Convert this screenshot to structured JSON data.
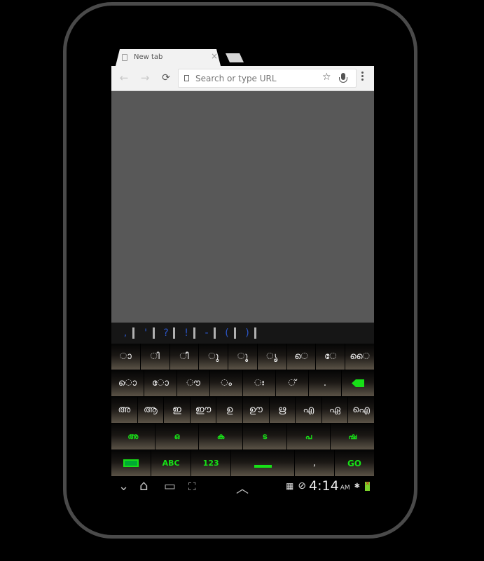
{
  "browser": {
    "tab_title": "New tab",
    "omnibox_placeholder": "Search or type URL",
    "icons": {
      "back": "←",
      "forward": "→",
      "reload": "⟳",
      "star": "☆",
      "close": "×"
    }
  },
  "suggestions": [
    ",",
    "'",
    "?",
    "!",
    "-",
    "(",
    ")"
  ],
  "keyboard": {
    "rows": [
      [
        "ാ",
        "ി",
        "ീ",
        "ു",
        "ൂ",
        "ൃ",
        "െ",
        "േ",
        "ൈ"
      ],
      [
        "ൊ",
        "ോ",
        "ൗ",
        "ം",
        "ഃ",
        "്",
        ".",
        "backspace"
      ],
      [
        "അ",
        "ആ",
        "ഇ",
        "ഈ",
        "ഉ",
        "ഊ",
        "ഋ",
        "എ",
        "ഏ",
        "ഐ"
      ],
      [
        "അ",
        "ഒ",
        "ക",
        "ട",
        "പ",
        "ഷ"
      ]
    ],
    "bottom_row": {
      "abc": "ABC",
      "num": "123",
      "comma": ",",
      "go": "GO"
    },
    "accent_color": "#17e017"
  },
  "navbar": {
    "icons": {
      "hide": "⌄",
      "home": "⌂",
      "recents": "▭",
      "screenshot": "⛶",
      "up": "︿"
    },
    "time": "4:14",
    "ampm": "AM",
    "bluetooth": "✱",
    "no_data": "⊘",
    "keyboard_status": "▦"
  }
}
